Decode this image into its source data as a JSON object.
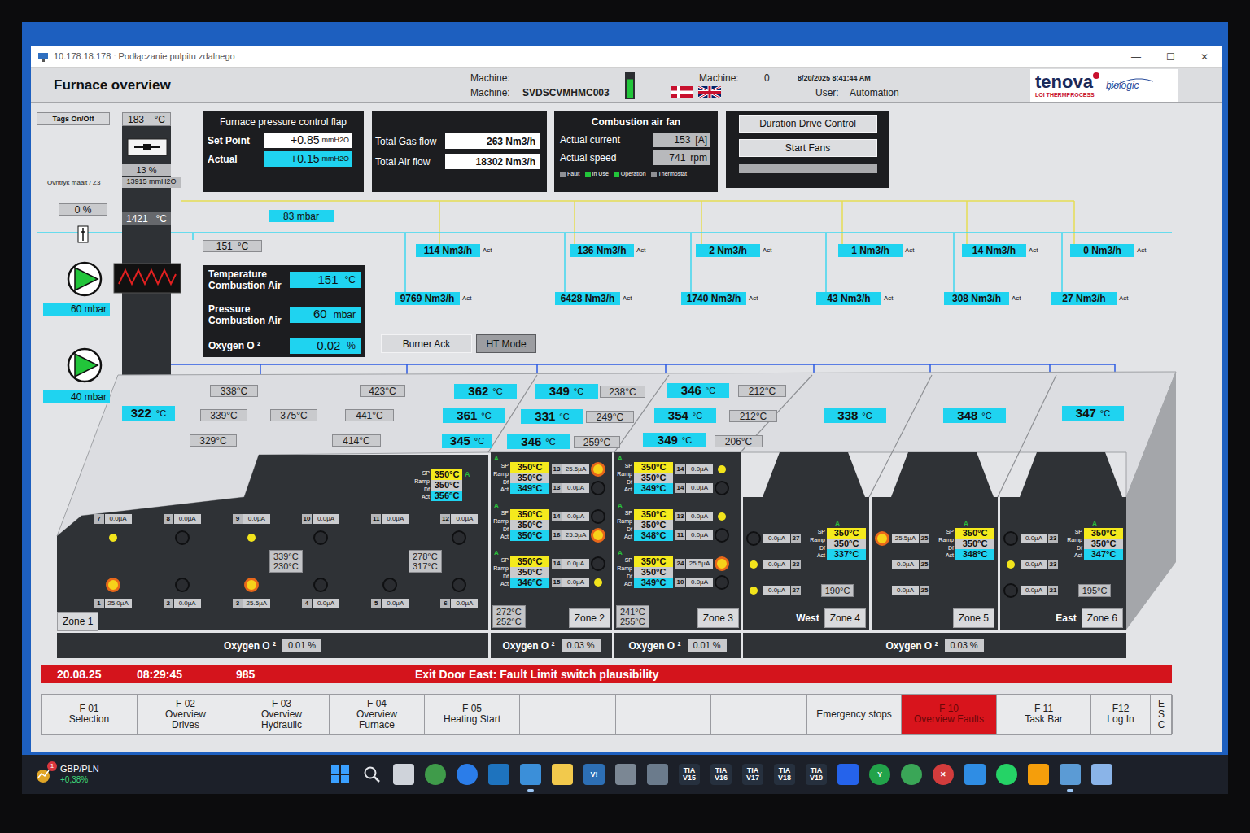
{
  "window": {
    "title": "10.178.18.178 : Podłączanie pulpitu zdalnego",
    "controls": [
      "—",
      "☐",
      "✕"
    ]
  },
  "header": {
    "title": "Furnace overview",
    "machine_labels": [
      "Machine:",
      "Machine:"
    ],
    "machine_name": "SVDSCVMHMC003",
    "gauge_level": 0.75,
    "machine2": {
      "label": "Machine:",
      "value": "0"
    },
    "datetime": "8/20/2025 8:41:44 AM",
    "user": {
      "label": "User:",
      "value": "Automation"
    },
    "logo": {
      "brand": "tenova",
      "sub": "LOI THERMPROCESS",
      "partner": "biologic"
    }
  },
  "stack": {
    "tags_button": "Tags On/Off",
    "top_temp": {
      "value": "183",
      "unit": "°C"
    },
    "flap": "13 %",
    "pressure_label": "Ovntryk maalt / Z3",
    "pressure": "13915 mmH2O",
    "hot_temp": {
      "value": "1421",
      "unit": "°C"
    },
    "valve": "0 %",
    "air_temp": {
      "value": "151",
      "unit": "°C"
    },
    "gas_pressure": "83 mbar",
    "bottom_temp": {
      "value": "322",
      "unit": "°C"
    },
    "pumps": [
      {
        "reading": "60 mbar",
        "running": true
      },
      {
        "reading": "40 mbar",
        "running": true
      }
    ]
  },
  "pressure_panel": {
    "title": "Furnace pressure control flap",
    "rows": [
      {
        "label": "Set Point",
        "value": "+0.85",
        "unit": "mmH2O",
        "kind": "setpoint"
      },
      {
        "label": "Actual",
        "value": "+0.15",
        "unit": "mmH2O",
        "kind": "actual"
      }
    ]
  },
  "flow_panel": {
    "rows": [
      {
        "label": "Total Gas flow",
        "value": "263 Nm3/h"
      },
      {
        "label": "Total Air flow",
        "value": "18302 Nm3/h"
      }
    ]
  },
  "fan_panel": {
    "title": "Combustion air fan",
    "rows": [
      {
        "label": "Actual current",
        "value": "153",
        "unit": "[A]"
      },
      {
        "label": "Actual speed",
        "value": "741",
        "unit": "rpm"
      }
    ],
    "legend": [
      {
        "label": "Fault",
        "color": "#8f9094"
      },
      {
        "label": "In Use",
        "color": "#22c53a"
      },
      {
        "label": "Operation",
        "color": "#22c53a"
      },
      {
        "label": "Thermostat",
        "color": "#8f9094"
      }
    ]
  },
  "control_panel": {
    "buttons": [
      "Duration Drive Control",
      "Start Fans"
    ],
    "level": 0
  },
  "combustion_air": {
    "rows": [
      {
        "label": "Temperature Combustion Air",
        "value": "151",
        "unit": "°C"
      },
      {
        "label": "Pressure Combustion Air",
        "value": "60",
        "unit": "mbar"
      },
      {
        "label": "Oxygen O ²",
        "value": "0.02",
        "unit": "%"
      }
    ],
    "actions": [
      {
        "label": "Burner Ack",
        "selected": false
      },
      {
        "label": "HT Mode",
        "selected": true
      }
    ]
  },
  "flows": {
    "act": "Act",
    "gas": [
      "114 Nm3/h",
      "136 Nm3/h",
      "2 Nm3/h",
      "1 Nm3/h",
      "14 Nm3/h",
      "0 Nm3/h"
    ],
    "air": [
      "9769 Nm3/h",
      "6428 Nm3/h",
      "1740 Nm3/h",
      "43 Nm3/h",
      "308 Nm3/h",
      "27 Nm3/h"
    ]
  },
  "furnace_temps": [
    {
      "value": "338",
      "unit": "°C",
      "kind": "reading"
    },
    {
      "value": "423",
      "unit": "°C",
      "kind": "reading"
    },
    {
      "value": "339",
      "unit": "°C",
      "kind": "reading"
    },
    {
      "value": "375",
      "unit": "°C",
      "kind": "reading"
    },
    {
      "value": "441",
      "unit": "°C",
      "kind": "reading"
    },
    {
      "value": "329",
      "unit": "°C",
      "kind": "reading"
    },
    {
      "value": "414",
      "unit": "°C",
      "kind": "reading"
    },
    {
      "value": "362",
      "unit": "°C",
      "kind": "actual"
    },
    {
      "value": "361",
      "unit": "°C",
      "kind": "actual"
    },
    {
      "value": "345",
      "unit": "°C",
      "kind": "actual"
    },
    {
      "value": "349",
      "unit": "°C",
      "kind": "actual"
    },
    {
      "value": "238",
      "unit": "°C",
      "kind": "reading"
    },
    {
      "value": "331",
      "unit": "°C",
      "kind": "actual"
    },
    {
      "value": "249",
      "unit": "°C",
      "kind": "reading"
    },
    {
      "value": "346",
      "unit": "°C",
      "kind": "actual"
    },
    {
      "value": "259",
      "unit": "°C",
      "kind": "reading"
    },
    {
      "value": "346",
      "unit": "°C",
      "kind": "actual"
    },
    {
      "value": "212",
      "unit": "°C",
      "kind": "reading"
    },
    {
      "value": "354",
      "unit": "°C",
      "kind": "actual"
    },
    {
      "value": "212",
      "unit": "°C",
      "kind": "reading"
    },
    {
      "value": "349",
      "unit": "°C",
      "kind": "actual"
    },
    {
      "value": "206",
      "unit": "°C",
      "kind": "reading"
    },
    {
      "value": "338",
      "unit": "°C",
      "kind": "actual"
    },
    {
      "value": "348",
      "unit": "°C",
      "kind": "actual"
    },
    {
      "value": "347",
      "unit": "°C",
      "kind": "actual"
    }
  ],
  "furnace": {
    "controller_labels": [
      "SP",
      "Ramp",
      "Df",
      "Act"
    ],
    "zones": [
      {
        "name": "Zone 1",
        "kind": "grid",
        "controllers": [
          {
            "auto": "A",
            "sp": "350°C",
            "ramp": "350°C",
            "act": "356°C"
          }
        ],
        "burners": [
          {
            "id": "7",
            "current": "0.0µA",
            "state": "on"
          },
          {
            "id": "8",
            "current": "0.0µA",
            "state": "off"
          },
          {
            "id": "9",
            "current": "0.0µA",
            "state": "on"
          },
          {
            "id": "10",
            "current": "0.0µA",
            "state": "off"
          },
          {
            "id": "11",
            "current": "0.0µA",
            "state": "none"
          },
          {
            "id": "12",
            "current": "0.0µA",
            "state": "off"
          },
          {
            "id": "1",
            "current": "25.0µA",
            "state": "flame"
          },
          {
            "id": "2",
            "current": "0.0µA",
            "state": "off"
          },
          {
            "id": "3",
            "current": "25.5µA",
            "state": "flame"
          },
          {
            "id": "4",
            "current": "0.0µA",
            "state": "off"
          },
          {
            "id": "5",
            "current": "0.0µA",
            "state": "off"
          },
          {
            "id": "6",
            "current": "0.0µA",
            "state": "off"
          }
        ],
        "temps": [
          [
            "339°C",
            "230°C"
          ],
          [
            "278°C",
            "317°C"
          ]
        ]
      },
      {
        "name": "Zone 2",
        "kind": "rows",
        "controllers": [
          {
            "auto": "A",
            "sp": "350°C",
            "ramp": "350°C",
            "act": "349°C"
          },
          {
            "auto": "A",
            "sp": "350°C",
            "ramp": "350°C",
            "act": "350°C"
          },
          {
            "auto": "A",
            "sp": "350°C",
            "ramp": "350°C",
            "act": "346°C"
          }
        ],
        "burners": [
          {
            "id": "13",
            "current": "25.5µA",
            "state": "flame"
          },
          {
            "id": "13",
            "current": "0.0µA",
            "state": "off"
          },
          {
            "id": "14",
            "current": "0.0µA",
            "state": "off"
          },
          {
            "id": "16",
            "current": "25.5µA",
            "state": "flame"
          },
          {
            "id": "14",
            "current": "0.0µA",
            "state": "off"
          },
          {
            "id": "15",
            "current": "0.0µA",
            "state": "on"
          }
        ],
        "temps": [
          [
            "272°C",
            "252°C"
          ]
        ]
      },
      {
        "name": "Zone 3",
        "kind": "rows",
        "controllers": [
          {
            "auto": "A",
            "sp": "350°C",
            "ramp": "350°C",
            "act": "349°C"
          },
          {
            "auto": "A",
            "sp": "350°C",
            "ramp": "350°C",
            "act": "348°C"
          },
          {
            "auto": "A",
            "sp": "350°C",
            "ramp": "350°C",
            "act": "349°C"
          }
        ],
        "burners": [
          {
            "id": "14",
            "current": "0.0µA",
            "state": "on"
          },
          {
            "id": "14",
            "current": "0.0µA",
            "state": "off"
          },
          {
            "id": "13",
            "current": "0.0µA",
            "state": "on"
          },
          {
            "id": "11",
            "current": "0.0µA",
            "state": "off"
          },
          {
            "id": "24",
            "current": "25.5µA",
            "state": "flame"
          },
          {
            "id": "10",
            "current": "0.0µA",
            "state": "off"
          }
        ],
        "temps": [
          [
            "241°C",
            "255°C"
          ]
        ]
      },
      {
        "name": "Zone 4",
        "kind": "hood",
        "side": "West",
        "controllers": [
          {
            "auto": "A",
            "sp": "350°C",
            "ramp": "350°C",
            "act": "337°C"
          }
        ],
        "burners": [
          {
            "id": "27",
            "current": "0.0µA",
            "state": "off"
          },
          {
            "id": "23",
            "current": "0.0µA",
            "state": "on"
          },
          {
            "id": "27",
            "current": "0.0µA",
            "state": "on"
          }
        ],
        "temps": [
          [
            "190°C"
          ]
        ]
      },
      {
        "name": "Zone 5",
        "kind": "hood",
        "controllers": [
          {
            "auto": "A",
            "sp": "350°C",
            "ramp": "350°C",
            "act": "348°C"
          }
        ],
        "burners": [
          {
            "id": "25",
            "current": "25.5µA",
            "state": "flame"
          },
          {
            "id": "25",
            "current": "0.0µA",
            "state": "none"
          },
          {
            "id": "25",
            "current": "0.0µA",
            "state": "none"
          }
        ],
        "temps": []
      },
      {
        "name": "Zone 6",
        "kind": "hood",
        "side": "East",
        "controllers": [
          {
            "auto": "A",
            "sp": "350°C",
            "ramp": "350°C",
            "act": "347°C"
          }
        ],
        "burners": [
          {
            "id": "23",
            "current": "0.0µA",
            "state": "off"
          },
          {
            "id": "23",
            "current": "0.0µA",
            "state": "on"
          },
          {
            "id": "21",
            "current": "0.0µA",
            "state": "off"
          }
        ],
        "temps": [
          [
            "195°C"
          ]
        ]
      }
    ],
    "oxygen": [
      {
        "label": "Oxygen O ²",
        "value": "0.01 %"
      },
      {
        "label": "Oxygen O ²",
        "value": "0.03 %"
      },
      {
        "label": "Oxygen O ²",
        "value": "0.01 %"
      },
      {
        "label": "Oxygen O ²",
        "value": "0.03 %"
      }
    ]
  },
  "alarm": {
    "date": "20.08.25",
    "time": "08:29:45",
    "code": "985",
    "message": "Exit Door East: Fault Limit switch plausibility"
  },
  "fkeys": [
    {
      "lines": [
        "F 01",
        "Selection"
      ],
      "selected": false
    },
    {
      "lines": [
        "F 02",
        "Overview",
        "Drives"
      ],
      "selected": false
    },
    {
      "lines": [
        "F 03",
        "Overview",
        "Hydraulic"
      ],
      "selected": false
    },
    {
      "lines": [
        "F 04",
        "Overview",
        "Furnace"
      ],
      "selected": false
    },
    {
      "lines": [
        "F 05",
        "Heating Start"
      ],
      "selected": false
    },
    {
      "lines": [],
      "selected": false
    },
    {
      "lines": [],
      "selected": false
    },
    {
      "lines": [],
      "selected": false
    },
    {
      "lines": [
        "Emergency stops"
      ],
      "selected": false
    },
    {
      "lines": [
        "F 10",
        "Overview Faults"
      ],
      "selected": true
    },
    {
      "lines": [
        "F 11",
        "Task Bar"
      ],
      "selected": false
    },
    {
      "lines": [
        "F12",
        "Log In"
      ],
      "selected": false
    },
    {
      "lines": [
        "E",
        "S",
        "C"
      ],
      "selected": false
    }
  ],
  "taskbar": {
    "ticker": {
      "symbol": "GBP/PLN",
      "change": "+0,38%",
      "badge": "1"
    },
    "icons": [
      {
        "kind": "windows",
        "color": "#3aa0ff",
        "label": [],
        "running": false
      },
      {
        "kind": "search",
        "color": "#e5e7eb",
        "label": [],
        "running": false
      },
      {
        "kind": "square",
        "color": "#cfd3da",
        "label": [],
        "running": false
      },
      {
        "kind": "circle",
        "color": "#3f9b4a",
        "label": [],
        "running": false
      },
      {
        "kind": "circle",
        "color": "#2b7de9",
        "label": [],
        "running": false
      },
      {
        "kind": "square",
        "color": "#1e73be",
        "label": [],
        "running": false
      },
      {
        "kind": "square",
        "color": "#3b8fd9",
        "label": [],
        "running": true
      },
      {
        "kind": "square",
        "color": "#f2c94c",
        "label": [],
        "running": false
      },
      {
        "kind": "square",
        "color": "#2d6fb5",
        "label": [
          "V!"
        ],
        "running": false
      },
      {
        "kind": "square",
        "color": "#7b8794",
        "label": [],
        "running": false
      },
      {
        "kind": "square",
        "color": "#6b7b8c",
        "label": [],
        "running": false
      },
      {
        "kind": "text",
        "color": "#26303e",
        "label": [
          "TIA",
          "V15"
        ],
        "running": false
      },
      {
        "kind": "text",
        "color": "#26303e",
        "label": [
          "TIA",
          "V16"
        ],
        "running": false
      },
      {
        "kind": "text",
        "color": "#26303e",
        "label": [
          "TIA",
          "V17"
        ],
        "running": false
      },
      {
        "kind": "text",
        "color": "#26303e",
        "label": [
          "TIA",
          "V18"
        ],
        "running": false
      },
      {
        "kind": "text",
        "color": "#26303e",
        "label": [
          "TIA",
          "V19"
        ],
        "running": false
      },
      {
        "kind": "square",
        "color": "#2563eb",
        "label": [],
        "running": false
      },
      {
        "kind": "circle",
        "color": "#22a34a",
        "label": [
          "Y"
        ],
        "running": false
      },
      {
        "kind": "circle",
        "color": "#3aa657",
        "label": [],
        "running": false
      },
      {
        "kind": "circle",
        "color": "#d23c3c",
        "label": [
          "✕"
        ],
        "running": false
      },
      {
        "kind": "square",
        "color": "#2f8de4",
        "label": [],
        "running": false
      },
      {
        "kind": "circle",
        "color": "#25d366",
        "label": [],
        "running": false
      },
      {
        "kind": "square",
        "color": "#f59e0b",
        "label": [],
        "running": false
      },
      {
        "kind": "square",
        "color": "#5b9bd5",
        "label": [],
        "running": true
      },
      {
        "kind": "square",
        "color": "#8ab4e8",
        "label": [],
        "running": false
      }
    ]
  }
}
